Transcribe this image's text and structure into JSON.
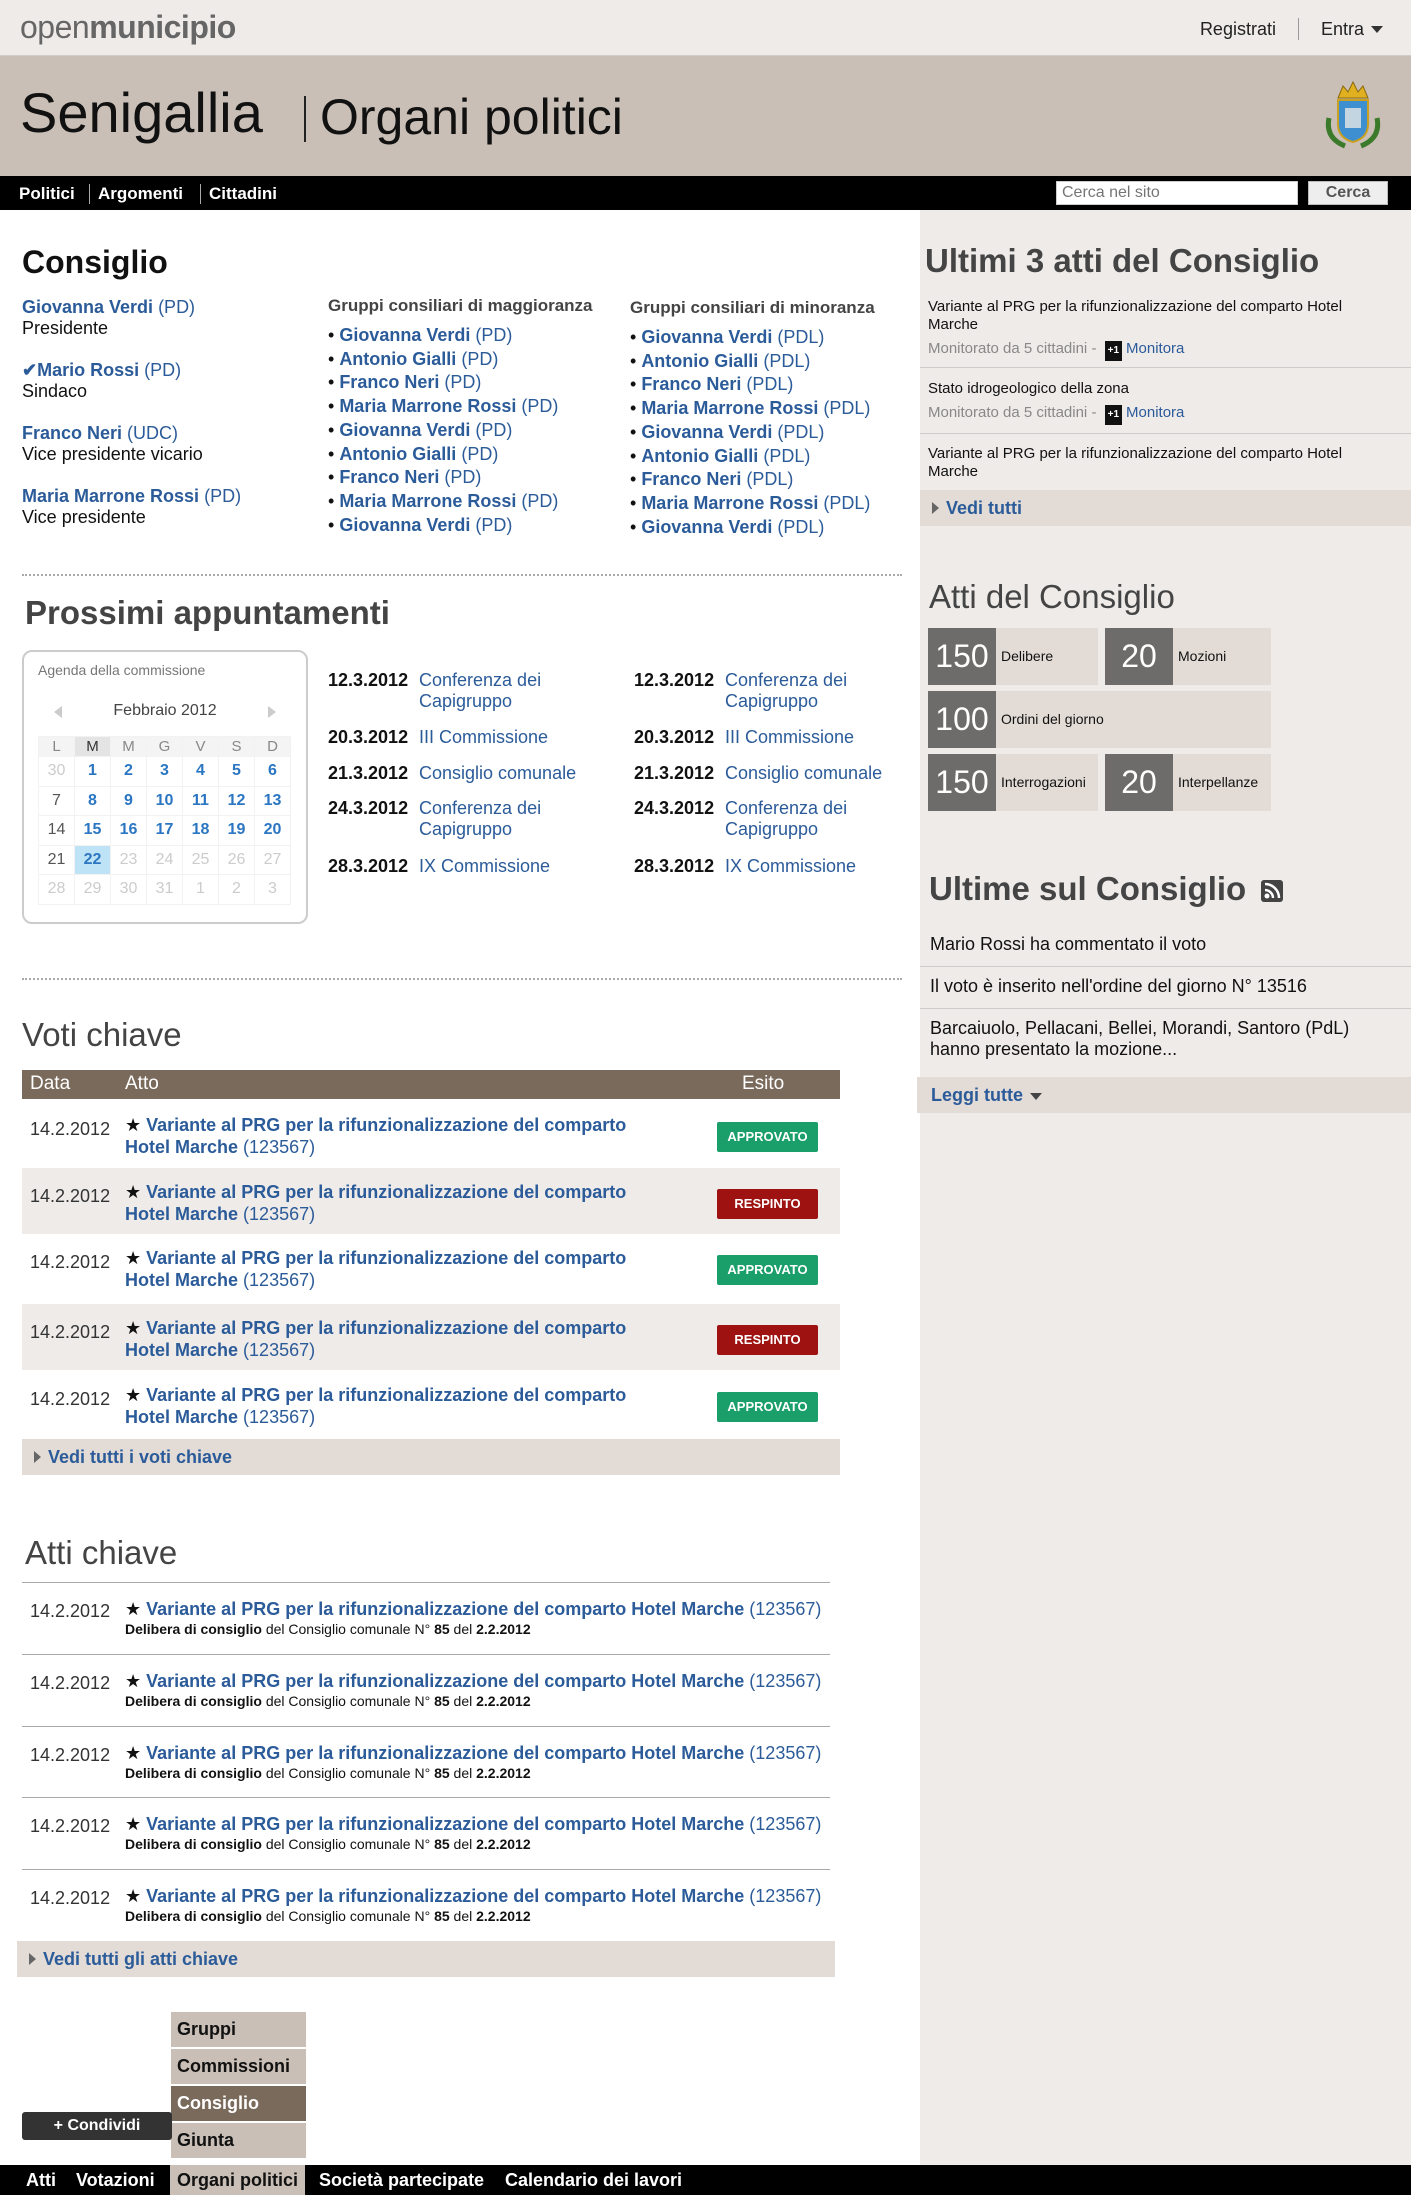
{
  "brand": {
    "light": "open",
    "bold": "municipio"
  },
  "topnav": {
    "register": "Registrati",
    "login": "Entra"
  },
  "banner": {
    "city": "Senigallia",
    "section": "Organi politici"
  },
  "mainnav": {
    "items": [
      "Politici",
      "Argomenti",
      "Cittadini"
    ],
    "search_placeholder": "Cerca nel sito",
    "search_button": "Cerca"
  },
  "council": {
    "title": "Consiglio",
    "officers": [
      {
        "name": "Giovanna Verdi",
        "party": "(PD)",
        "role": "Presidente",
        "check": ""
      },
      {
        "name": "Mario Rossi",
        "party": "(PD)",
        "role": "Sindaco",
        "check": "✔"
      },
      {
        "name": "Franco Neri",
        "party": "(UDC)",
        "role": "Vice presidente vicario",
        "check": ""
      },
      {
        "name": "Maria Marrone Rossi",
        "party": "(PD)",
        "role": "Vice presidente",
        "check": ""
      }
    ],
    "majority": {
      "heading": "Gruppi consiliari di maggioranza",
      "members": [
        {
          "name": "Giovanna Verdi",
          "party": "(PD)"
        },
        {
          "name": "Antonio Gialli",
          "party": "(PD)"
        },
        {
          "name": "Franco Neri",
          "party": "(PD)"
        },
        {
          "name": "Maria Marrone Rossi",
          "party": "(PD)"
        },
        {
          "name": "Giovanna Verdi",
          "party": "(PD)"
        },
        {
          "name": "Antonio Gialli",
          "party": "(PD)"
        },
        {
          "name": "Franco Neri",
          "party": "(PD)"
        },
        {
          "name": "Maria Marrone Rossi",
          "party": "(PD)"
        },
        {
          "name": "Giovanna Verdi",
          "party": "(PD)"
        }
      ]
    },
    "minority": {
      "heading": "Gruppi consiliari di minoranza",
      "members": [
        {
          "name": "Giovanna Verdi",
          "party": "(PDL)"
        },
        {
          "name": "Antonio Gialli",
          "party": "(PDL)"
        },
        {
          "name": "Franco Neri",
          "party": "(PDL)"
        },
        {
          "name": "Maria Marrone Rossi",
          "party": "(PDL)"
        },
        {
          "name": "Giovanna Verdi",
          "party": "(PDL)"
        },
        {
          "name": "Antonio Gialli",
          "party": "(PDL)"
        },
        {
          "name": "Franco Neri",
          "party": "(PDL)"
        },
        {
          "name": "Maria Marrone Rossi",
          "party": "(PDL)"
        },
        {
          "name": "Giovanna Verdi",
          "party": "(PDL)"
        }
      ]
    }
  },
  "appointments": {
    "title": "Prossimi appuntamenti",
    "calendar": {
      "title": "Agenda della commissione",
      "month": "Febbraio 2012",
      "weekdays": [
        "L",
        "M",
        "M",
        "G",
        "V",
        "S",
        "D"
      ],
      "weeks": [
        [
          "30",
          "1",
          "2",
          "3",
          "4",
          "5",
          "6"
        ],
        [
          "7",
          "8",
          "9",
          "10",
          "11",
          "12",
          "13"
        ],
        [
          "14",
          "15",
          "16",
          "17",
          "18",
          "19",
          "20"
        ],
        [
          "21",
          "22",
          "23",
          "24",
          "25",
          "26",
          "27"
        ],
        [
          "28",
          "29",
          "30",
          "31",
          "1",
          "2",
          "3"
        ]
      ]
    },
    "col1": [
      {
        "date": "12.3.2012",
        "title": "Conferenza dei Capigruppo"
      },
      {
        "date": "20.3.2012",
        "title": "III Commissione"
      },
      {
        "date": "21.3.2012",
        "title": "Consiglio comunale"
      },
      {
        "date": "24.3.2012",
        "title": "Conferenza dei Capigruppo"
      },
      {
        "date": "28.3.2012",
        "title": "IX Commissione"
      }
    ],
    "col2": [
      {
        "date": "12.3.2012",
        "title": "Conferenza dei Capigruppo"
      },
      {
        "date": "20.3.2012",
        "title": "III Commissione"
      },
      {
        "date": "21.3.2012",
        "title": "Consiglio comunale"
      },
      {
        "date": "24.3.2012",
        "title": "Conferenza dei Capigruppo"
      },
      {
        "date": "28.3.2012",
        "title": "IX Commissione"
      }
    ]
  },
  "key_votes": {
    "title": "Voti chiave",
    "headers": [
      "Data",
      "Atto",
      "Esito"
    ],
    "rows": [
      {
        "date": "14.2.2012",
        "title": "Variante al PRG per la rifunzionalizzazione del comparto Hotel Marche",
        "code": "(123567)",
        "outcome": "APPROVATO"
      },
      {
        "date": "14.2.2012",
        "title": "Variante al PRG per la rifunzionalizzazione del comparto Hotel Marche",
        "code": "(123567)",
        "outcome": "RESPINTO"
      },
      {
        "date": "14.2.2012",
        "title": "Variante al PRG per la rifunzionalizzazione del comparto Hotel Marche",
        "code": "(123567)",
        "outcome": "APPROVATO"
      },
      {
        "date": "14.2.2012",
        "title": "Variante al PRG per la rifunzionalizzazione del comparto Hotel Marche",
        "code": "(123567)",
        "outcome": "RESPINTO"
      },
      {
        "date": "14.2.2012",
        "title": "Variante al PRG per la rifunzionalizzazione del comparto Hotel Marche",
        "code": "(123567)",
        "outcome": "APPROVATO"
      }
    ],
    "more": "Vedi tutti i voti chiave"
  },
  "key_acts": {
    "title": "Atti chiave",
    "rows": [
      {
        "date": "14.2.2012",
        "title": "Variante al PRG per la rifunzionalizzazione del comparto Hotel Marche",
        "code": "(123567)",
        "type": "Delibera di consiglio",
        "mid": "del Consiglio comunale N°",
        "num": "85",
        "del": "del",
        "when": "2.2.2012"
      },
      {
        "date": "14.2.2012",
        "title": "Variante al PRG per la rifunzionalizzazione del comparto Hotel Marche",
        "code": "(123567)",
        "type": "Delibera di consiglio",
        "mid": "del Consiglio comunale N°",
        "num": "85",
        "del": "del",
        "when": "2.2.2012"
      },
      {
        "date": "14.2.2012",
        "title": "Variante al PRG per la rifunzionalizzazione del comparto Hotel Marche",
        "code": "(123567)",
        "type": "Delibera di consiglio",
        "mid": "del Consiglio comunale N°",
        "num": "85",
        "del": "del",
        "when": "2.2.2012"
      },
      {
        "date": "14.2.2012",
        "title": "Variante al PRG per la rifunzionalizzazione del comparto Hotel Marche",
        "code": "(123567)",
        "type": "Delibera di consiglio",
        "mid": "del Consiglio comunale N°",
        "num": "85",
        "del": "del",
        "when": "2.2.2012"
      },
      {
        "date": "14.2.2012",
        "title": "Variante al PRG per la rifunzionalizzazione del comparto Hotel Marche",
        "code": "(123567)",
        "type": "Delibera di consiglio",
        "mid": "del Consiglio comunale N°",
        "num": "85",
        "del": "del",
        "when": "2.2.2012"
      }
    ],
    "more": "Vedi tutti gli atti chiave"
  },
  "sidebar": {
    "last_acts": {
      "title": "Ultimi 3 atti del Consiglio",
      "items": [
        {
          "title": "Variante al PRG per la rifunzionalizzazione del comparto Hotel Marche",
          "monitor": "Monitorato da 5 cittadini",
          "dash": "-",
          "plus": "+1",
          "action": "Monitora"
        },
        {
          "title": "Stato idrogeologico della zona",
          "monitor": "Monitorato da 5 cittadini",
          "dash": "-",
          "plus": "+1",
          "action": "Monitora"
        },
        {
          "title": "Variante al PRG per la rifunzionalizzazione del comparto Hotel Marche"
        }
      ],
      "more": "Vedi tutti"
    },
    "acts": {
      "title": "Atti del Consiglio",
      "boxes": [
        {
          "num": "150",
          "label": "Delibere"
        },
        {
          "num": "20",
          "label": "Mozioni"
        },
        {
          "num": "100",
          "label": "Ordini del giorno"
        },
        {
          "num": "150",
          "label": "Interrogazioni"
        },
        {
          "num": "20",
          "label": "Interpellanze"
        }
      ]
    },
    "news": {
      "title": "Ultime sul Consiglio",
      "items": [
        "Mario Rossi ha commentato il voto",
        "Il voto è inserito nell'ordine del giorno N° 13516",
        "Barcaiuolo, Pellacani, Bellei, Morandi, Santoro (PdL) hanno presentato la mozione..."
      ],
      "more": "Leggi tutte"
    }
  },
  "tabs": [
    "Gruppi",
    "Commissioni",
    "Consiglio",
    "Giunta"
  ],
  "share": "+ Condividi",
  "footer": [
    "Atti",
    "Votazioni",
    "Organi politici",
    "Società partecipate",
    "Calendario dei lavori"
  ]
}
